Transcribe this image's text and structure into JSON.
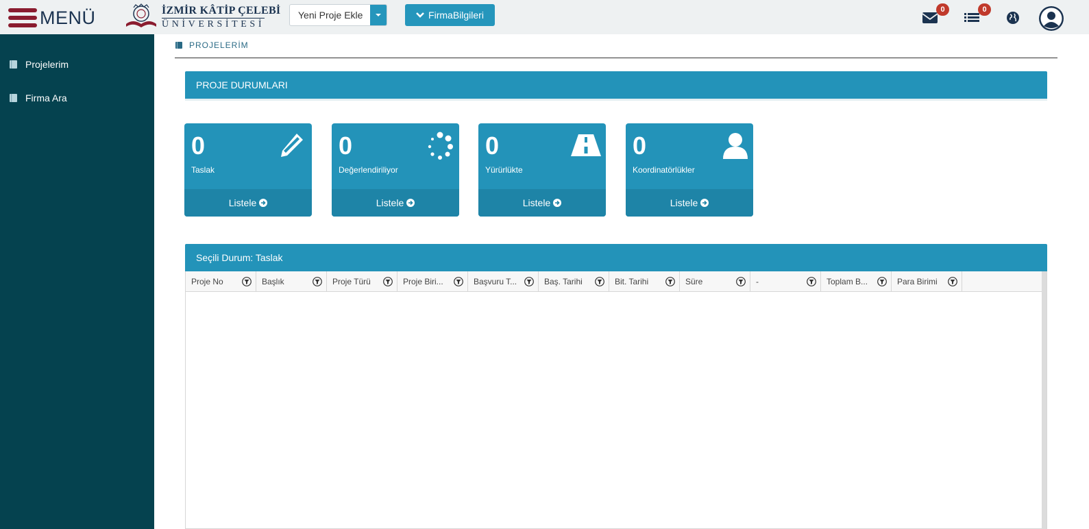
{
  "header": {
    "menu_label": "MENÜ",
    "logo_line1": "İZMİR KÂTİP ÇELEBİ",
    "logo_line2": "ÜNİVERSİTESİ",
    "project_select_value": "Yeni Proje Ekle",
    "firma_button": "FirmaBilgileri",
    "mail_badge": "0",
    "list_badge": "0",
    "icons": [
      "envelope-icon",
      "list-icon",
      "globe-icon",
      "user-avatar-icon"
    ]
  },
  "sidebar": {
    "items": [
      {
        "label": "Projelerim",
        "icon": "book-icon"
      },
      {
        "label": "Firma Ara",
        "icon": "book-icon"
      }
    ]
  },
  "breadcrumb": {
    "label": "PROJELERİM",
    "icon": "book-icon"
  },
  "status_panel": {
    "title": "PROJE DURUMLARI"
  },
  "tiles": [
    {
      "count": "0",
      "label": "Taslak",
      "link": "Listele",
      "icon": "pencil-icon"
    },
    {
      "count": "0",
      "label": "Değerlendiriliyor",
      "link": "Listele",
      "icon": "spinner-icon"
    },
    {
      "count": "0",
      "label": "Yürürlükte",
      "link": "Listele",
      "icon": "road-icon"
    },
    {
      "count": "0",
      "label": "Koordinatörlükler",
      "link": "Listele",
      "icon": "user-icon"
    }
  ],
  "selected_panel": {
    "title": "Seçili Durum: Taslak"
  },
  "grid": {
    "columns": [
      "Proje No",
      "Başlık",
      "Proje Türü",
      "Proje Biri...",
      "Başvuru T...",
      "Baş. Tarihi",
      "Bit. Tarihi",
      "Süre",
      "-",
      "Toplam B...",
      "Para Birimi"
    ]
  },
  "colors": {
    "accent": "#2393b9",
    "sidebar": "#05424f",
    "brand_red": "#8a1c2f",
    "badge": "#c0392b"
  }
}
